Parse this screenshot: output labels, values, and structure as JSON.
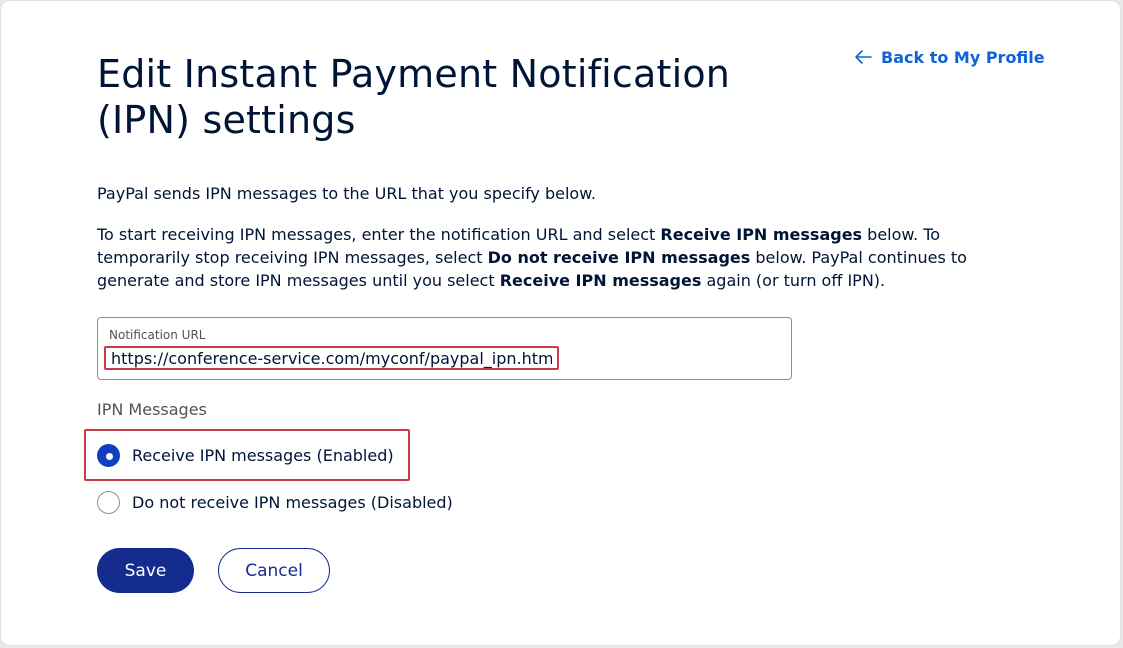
{
  "header": {
    "back_link": "Back to My Profile",
    "title": "Edit Instant Payment Notification (IPN) settings"
  },
  "intro": {
    "line1": "PayPal sends IPN messages to the URL that you specify below.",
    "p2_a": "To start receiving IPN messages, enter the notification URL and select ",
    "p2_b": "Receive IPN messages",
    "p2_c": " below. To temporarily stop receiving IPN messages, select ",
    "p2_d": "Do not receive IPN messages",
    "p2_e": " below. PayPal continues to generate and store IPN messages until you select ",
    "p2_f": "Receive IPN messages",
    "p2_g": " again (or turn off IPN)."
  },
  "notification_url": {
    "label": "Notification URL",
    "value": "https://conference-service.com/myconf/paypal_ipn.html"
  },
  "ipn_messages": {
    "label": "IPN Messages",
    "options": [
      {
        "label": "Receive IPN messages (Enabled)",
        "selected": true
      },
      {
        "label": "Do not receive IPN messages (Disabled)",
        "selected": false
      }
    ]
  },
  "actions": {
    "save_label": "Save",
    "cancel_label": "Cancel"
  },
  "colors": {
    "link": "#0d64d8",
    "primary_button": "#142c8e",
    "radio_selected": "#1040c1",
    "highlight_box": "#c9394a"
  },
  "icons": {
    "back": "arrow-left-icon"
  }
}
